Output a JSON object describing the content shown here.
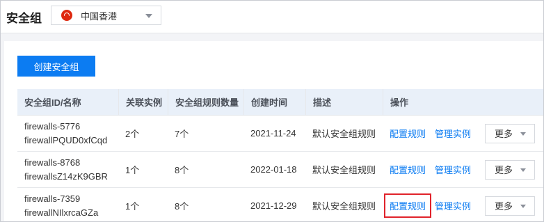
{
  "header": {
    "title": "安全组",
    "region": {
      "label": "中国香港",
      "icon": "hong-kong-flag-icon"
    }
  },
  "toolbar": {
    "create_label": "创建安全组"
  },
  "table": {
    "columns": [
      "安全组ID/名称",
      "关联实例",
      "安全组规则数量",
      "创建时间",
      "描述",
      "操作"
    ],
    "rows": [
      {
        "id": "firewalls-5776",
        "name": "firewallPQUD0xfCqd",
        "instances": "2个",
        "rules": "7个",
        "created": "2021-11-24",
        "desc": "默认安全组规则",
        "op_config": "配置规则",
        "op_manage": "管理实例",
        "op_more": "更多"
      },
      {
        "id": "firewalls-8768",
        "name": "firewallsZ14zK9GBR",
        "instances": "1个",
        "rules": "8个",
        "created": "2022-01-18",
        "desc": "默认安全组规则",
        "op_config": "配置规则",
        "op_manage": "管理实例",
        "op_more": "更多"
      },
      {
        "id": "firewalls-7359",
        "name": "firewallNIlxrcaGZa",
        "instances": "1个",
        "rules": "8个",
        "created": "2021-12-29",
        "desc": "默认安全组规则",
        "op_config": "配置规则",
        "op_manage": "管理实例",
        "op_more": "更多"
      }
    ]
  },
  "colors": {
    "accent": "#0c7cf2",
    "highlight": "#e0232b",
    "header_bg": "#e9f0f9"
  }
}
